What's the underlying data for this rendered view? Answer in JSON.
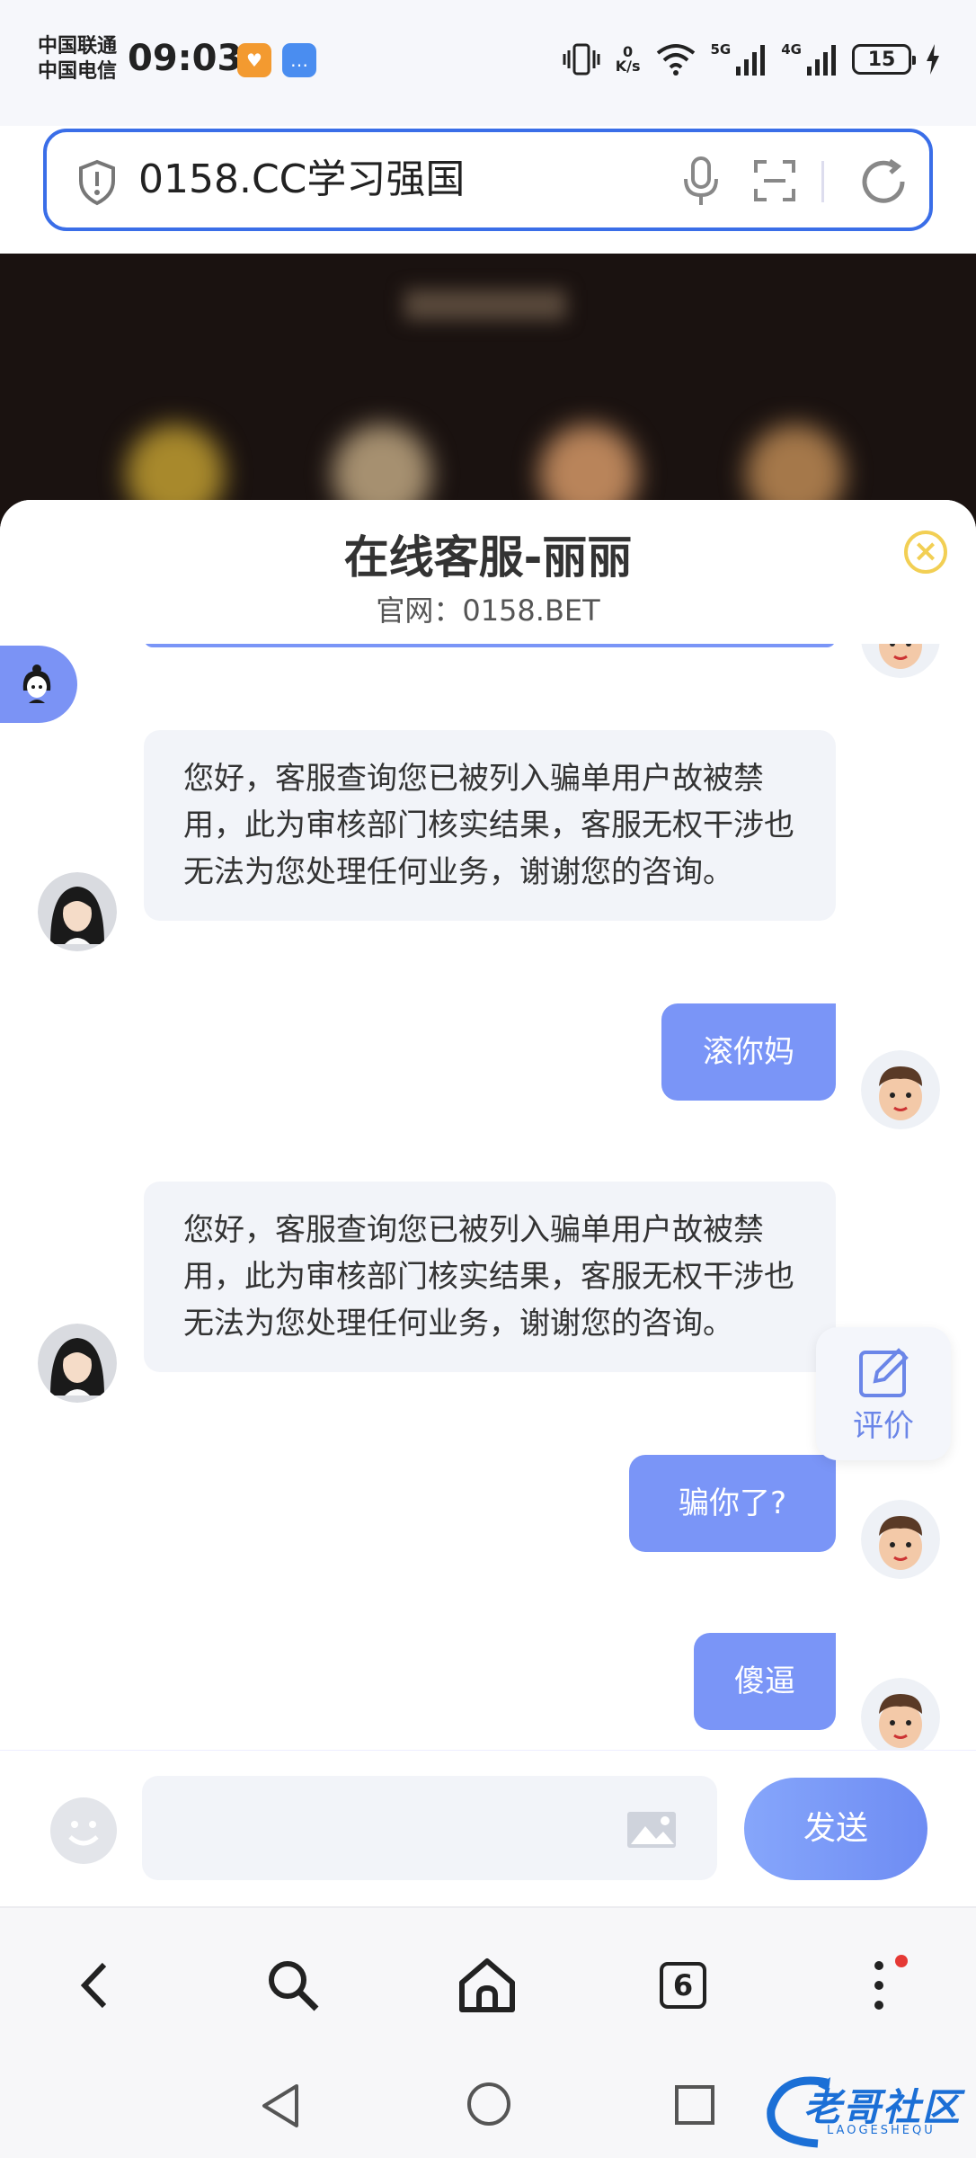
{
  "status_bar": {
    "carrier_1": "中国联通",
    "carrier_2": "中国电信",
    "time": "09:03",
    "net_speed_value": "0",
    "net_speed_unit": "K/s",
    "signal_1": "5G",
    "signal_2": "4G",
    "battery": "15"
  },
  "url_bar": {
    "text": "0158.CC学习强国"
  },
  "chat": {
    "title": "在线客服-丽丽",
    "subtitle": "官网：0158.BET",
    "messages": [
      {
        "side": "agent",
        "text": "您好，客服查询您已被列入骗单用户故被禁用，此为审核部门核实结果，客服无权干涉也无法为您处理任何业务，谢谢您的咨询。"
      },
      {
        "side": "user",
        "text": "滚你妈"
      },
      {
        "side": "agent",
        "text": "您好，客服查询您已被列入骗单用户故被禁用，此为审核部门核实结果，客服无权干涉也无法为您处理任何业务，谢谢您的咨询。"
      },
      {
        "side": "user",
        "text": "骗你了?"
      },
      {
        "side": "user",
        "text": "傻逼"
      }
    ],
    "rate_label": "评价",
    "input_placeholder": "",
    "send_label": "发送"
  },
  "browser_nav": {
    "tabs_count": "6"
  },
  "watermark": {
    "text": "老哥社区",
    "sub": "LAOGESHEQU"
  },
  "colors": {
    "accent": "#7a95f7",
    "url_border": "#3a6ee8",
    "close": "#f2cf54",
    "agent_bubble": "#f2f4f9"
  }
}
